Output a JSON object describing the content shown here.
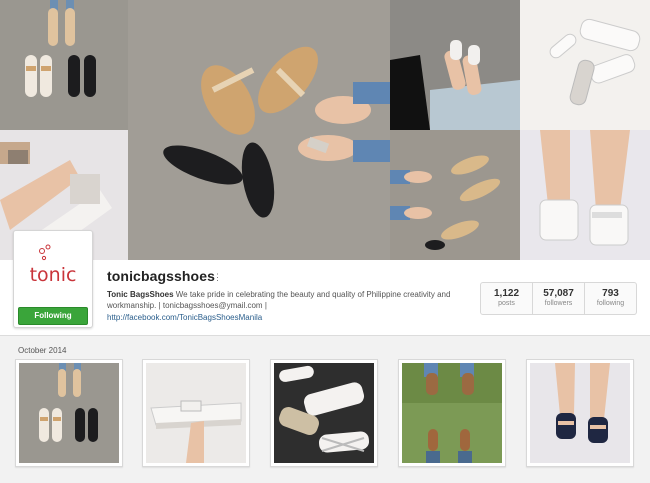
{
  "profile": {
    "username": "tonicbagsshoes",
    "logo_text": "tonic",
    "follow_label": "Following",
    "bio_name": "Tonic BagsShoes",
    "bio_text": " We take pride in celebrating the beauty and quality of Philippine creativity and workmanship. | tonicbagsshoes@ymail.com |",
    "website": "http://facebook.com/TonicBagsShoesManila",
    "menu_icon": "more-dots-icon"
  },
  "stats": [
    {
      "value": "1,122",
      "label": "posts"
    },
    {
      "value": "57,087",
      "label": "followers"
    },
    {
      "value": "793",
      "label": "following"
    }
  ],
  "feed": {
    "month_label": "October 2014"
  },
  "colors": {
    "follow_green": "#3aa53a",
    "link_blue": "#2a5e8c",
    "logo_red": "#c9343a"
  }
}
